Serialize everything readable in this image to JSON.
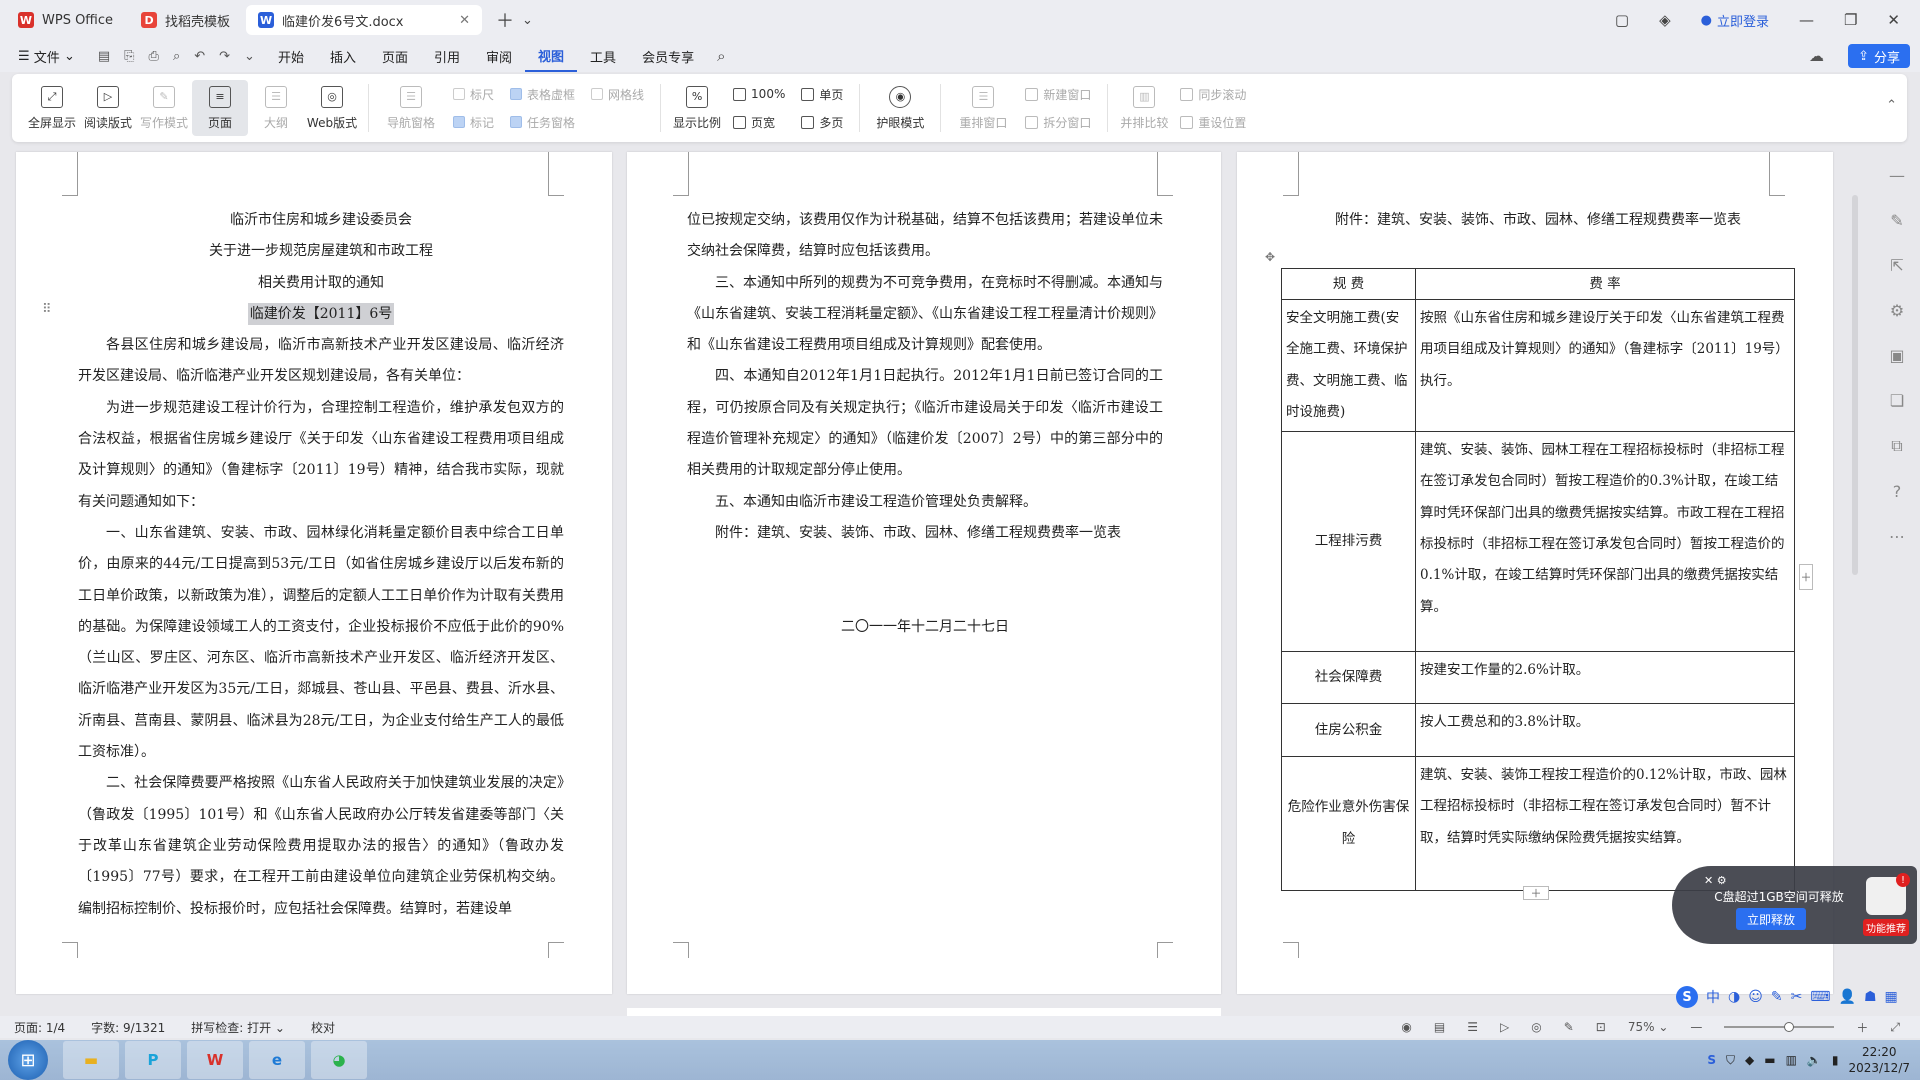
{
  "tabs": [
    {
      "label": "WPS Office",
      "color": "#d9312b",
      "glyph": "W"
    },
    {
      "label": "找稻壳模板",
      "color": "#e8443a",
      "glyph": "D"
    },
    {
      "label": "临建价发6号文.docx",
      "color": "#2b5fd9",
      "glyph": "W"
    }
  ],
  "header": {
    "login": "立即登录",
    "share": "分享"
  },
  "menu": {
    "file": "文件",
    "items": [
      "开始",
      "插入",
      "页面",
      "引用",
      "审阅",
      "视图",
      "工具",
      "会员专享"
    ],
    "active": "视图"
  },
  "ribbon": {
    "big": [
      {
        "label": "全屏显示",
        "glyph": "⤢",
        "state": ""
      },
      {
        "label": "阅读版式",
        "glyph": "▷",
        "state": ""
      },
      {
        "label": "写作模式",
        "glyph": "✎",
        "state": "dis"
      },
      {
        "label": "页面",
        "glyph": "≡",
        "state": "active"
      },
      {
        "label": "大纲",
        "glyph": "☰",
        "state": "dis"
      },
      {
        "label": "Web版式",
        "glyph": "◎",
        "state": ""
      }
    ],
    "nav_pane": "导航窗格",
    "checks": [
      {
        "label": "标尺",
        "on": false
      },
      {
        "label": "表格虚框",
        "on": true
      },
      {
        "label": "网格线",
        "on": false
      },
      {
        "label": "标记",
        "on": true
      },
      {
        "label": "任务窗格",
        "on": true
      }
    ],
    "zoom": {
      "ratio": "显示比例",
      "pct": "100%",
      "page_width": "页宽",
      "single": "单页",
      "multi": "多页"
    },
    "eye": "护眼模式",
    "window": {
      "rearrange": "重排窗口",
      "new_window": "新建窗口",
      "split": "拆分窗口",
      "side_by_side": "并排比较",
      "sync_scroll": "同步滚动",
      "reset_pos": "重设位置"
    }
  },
  "page1": {
    "title1": "临沂市住房和城乡建设委员会",
    "title2": "关于进一步规范房屋建筑和市政工程",
    "title3": "相关费用计取的通知",
    "docno": "临建价发【2011】6号",
    "paras": [
      "各县区住房和城乡建设局，临沂市高新技术产业开发区建设局、临沂经济开发区建设局、临沂临港产业开发区规划建设局，各有关单位：",
      "为进一步规范建设工程计价行为，合理控制工程造价，维护承发包双方的合法权益，根据省住房城乡建设厅《关于印发〈山东省建设工程费用项目组成及计算规则〉的通知》（鲁建标字〔2011〕19号）精神，结合我市实际，现就有关问题通知如下：",
      "一、山东省建筑、安装、市政、园林绿化消耗量定额价目表中综合工日单价，由原来的44元/工日提高到53元/工日（如省住房城乡建设厅以后发布新的工日单价政策，以新政策为准），调整后的定额人工工日单价作为计取有关费用的基础。为保障建设领域工人的工资支付，企业投标报价不应低于此价的90%（兰山区、罗庄区、河东区、临沂市高新技术产业开发区、临沂经济开发区、临沂临港产业开发区为35元/工日，郯城县、苍山县、平邑县、费县、沂水县、沂南县、莒南县、蒙阴县、临沭县为28元/工日，为企业支付给生产工人的最低工资标准）。",
      "二、社会保障费要严格按照《山东省人民政府关于加快建筑业发展的决定》（鲁政发〔1995〕101号）和《山东省人民政府办公厅转发省建委等部门〈关于改革山东省建筑企业劳动保险费用提取办法的报告〉的通知》（鲁政办发〔1995〕77号）要求，在工程开工前由建设单位向建筑企业劳保机构交纳。编制招标控制价、投标报价时，应包括社会保障费。结算时，若建设单"
    ]
  },
  "page2": {
    "paras": [
      "位已按规定交纳，该费用仅作为计税基础，结算不包括该费用；若建设单位未交纳社会保障费，结算时应包括该费用。",
      "三、本通知中所列的规费为不可竞争费用，在竞标时不得删减。本通知与《山东省建筑、安装工程消耗量定额》、《山东省建设工程工程量清计价规则》和《山东省建设工程费用项目组成及计算规则》配套使用。",
      "四、本通知自2012年1月1日起执行。2012年1月1日前已签订合同的工程，可仍按原合同及有关规定执行；《临沂市建设局关于印发〈临沂市建设工程造价管理补充规定〉的通知》（临建价发〔2007〕2号）中的第三部分中的相关费用的计取规定部分停止使用。",
      "五、本通知由临沂市建设工程造价管理处负责解释。",
      "附件：建筑、安装、装饰、市政、园林、修缮工程规费费率一览表"
    ],
    "date": "二〇一一年十二月二十七日"
  },
  "page3": {
    "caption": "附件：建筑、安装、装饰、市政、园林、修缮工程规费费率一览表",
    "headers": [
      "规  费",
      "费  率"
    ],
    "rows": [
      {
        "name": "安全文明施工费(安全施工费、环境保护费、文明施工费、临时设施费)",
        "rate": "按照《山东省住房和城乡建设厅关于印发〈山东省建筑工程费用项目组成及计算规则〉的通知》（鲁建标字〔2011〕19号）执行。",
        "h": 128,
        "left": true
      },
      {
        "name": "工程排污费",
        "rate": "建筑、安装、装饰、园林工程在工程招标投标时（非招标工程在签订承发包合同时）暂按工程造价的0.3%计取，在竣工结算时凭环保部门出具的缴费凭据按实结算。市政工程在工程招标投标时（非招标工程在签订承发包合同时）暂按工程造价的0.1%计取，在竣工结算时凭环保部门出具的缴费凭据按实结算。",
        "h": 220,
        "left": false
      },
      {
        "name": "社会保障费",
        "rate": "按建安工作量的2.6%计取。",
        "h": 52,
        "left": false
      },
      {
        "name": "住房公积金",
        "rate": "按人工费总和的3.8%计取。",
        "h": 53,
        "left": false
      },
      {
        "name": "危险作业意外伤害保险",
        "rate": "建筑、安装、装饰工程按工程造价的0.12%计取，市政、园林工程招标投标时（非招标工程在签订承发包合同时）暂不计取，结算时凭实际缴纳保险费凭据按实结算。",
        "h": 134,
        "left": false
      }
    ]
  },
  "popup": {
    "message": "C盘超过1GB空间可释放",
    "button": "立即释放",
    "badge": "功能推荐"
  },
  "status": {
    "page": "页面: 1/4",
    "words": "字数: 9/1321",
    "spell": "拼写检查: 打开",
    "proof": "校对",
    "zoom": "75%"
  },
  "taskbar": {
    "time": "22:20",
    "date": "2023/12/7"
  }
}
